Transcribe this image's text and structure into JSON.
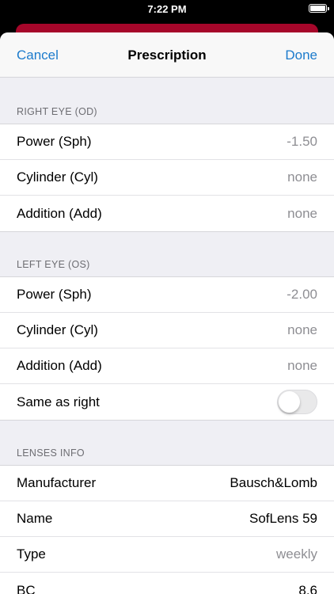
{
  "status_bar": {
    "time": "7:22 PM"
  },
  "nav": {
    "cancel": "Cancel",
    "title": "Prescription",
    "done": "Done"
  },
  "right_eye": {
    "header": "RIGHT EYE (OD)",
    "rows": [
      {
        "label": "Power (Sph)",
        "value": "-1.50"
      },
      {
        "label": "Cylinder (Cyl)",
        "value": "none"
      },
      {
        "label": "Addition (Add)",
        "value": "none"
      }
    ]
  },
  "left_eye": {
    "header": "LEFT EYE (OS)",
    "rows": [
      {
        "label": "Power (Sph)",
        "value": "-2.00"
      },
      {
        "label": "Cylinder (Cyl)",
        "value": "none"
      },
      {
        "label": "Addition (Add)",
        "value": "none"
      }
    ],
    "same_as_right": {
      "label": "Same as right",
      "on": false
    }
  },
  "lenses": {
    "header": "LENSES INFO",
    "rows": [
      {
        "label": "Manufacturer",
        "value": "Bausch&Lomb"
      },
      {
        "label": "Name",
        "value": "SofLens 59"
      },
      {
        "label": "Type",
        "value": "weekly"
      },
      {
        "label": "BC",
        "value": "8.6"
      }
    ]
  },
  "colors": {
    "accent": "#1c7bcc",
    "back_card": "#a6062a"
  }
}
